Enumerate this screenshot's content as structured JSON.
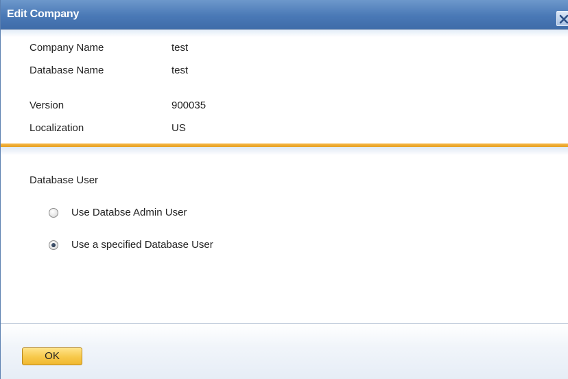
{
  "window": {
    "title": "Edit Company",
    "close_icon": "close-icon"
  },
  "company_info": [
    {
      "label": "Company Name",
      "value": "test"
    },
    {
      "label": "Database Name",
      "value": "test"
    },
    {
      "label": "Version",
      "value": "900035"
    },
    {
      "label": "Localization",
      "value": "US"
    }
  ],
  "database_user": {
    "title": "Database User",
    "options": [
      {
        "label": "Use Databse Admin User",
        "selected": false
      },
      {
        "label": "Use a specified Database User",
        "selected": true
      }
    ]
  },
  "footer": {
    "ok_label": "OK"
  },
  "colors": {
    "titlebar": "#4a79b6",
    "separator": "#f0a830",
    "ok_button": "#f7c84a"
  }
}
